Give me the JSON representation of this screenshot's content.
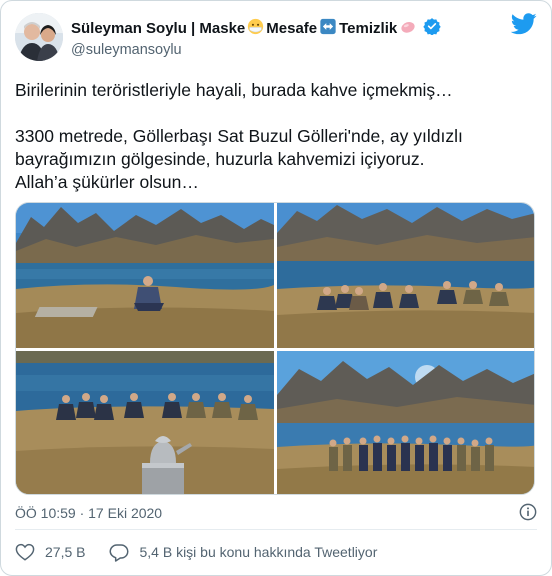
{
  "user": {
    "display_name_parts": [
      "Süleyman Soylu | Maske",
      "Mesafe",
      "Temizlik"
    ],
    "handle": "@suleymansoylu",
    "icons": [
      "mask-emoji-icon",
      "left-right-arrow-emoji-icon",
      "soap-emoji-icon",
      "verified-badge-icon",
      "twitter-bird-icon"
    ],
    "accent_color": "#1d9bf0"
  },
  "tweet": {
    "line_1": "Birilerinin teröristleriyle hayali, burada kahve içmekmiş…",
    "line_2": "3300 metrede, Göllerbaşı Sat Buzul Gölleri'nde, ay yıldızlı",
    "line_3": "bayrağımızın gölgesinde, huzurla kahvemizi içiyoruz.",
    "line_4": "Allah’a şükürler olsun…"
  },
  "meta": {
    "timestamp": "ÖÖ 10:59 · 17 Eki 2020"
  },
  "actions": {
    "likes": "27,5 B",
    "talking": "5,4 B kişi bu konu hakkında Tweetliyor"
  }
}
